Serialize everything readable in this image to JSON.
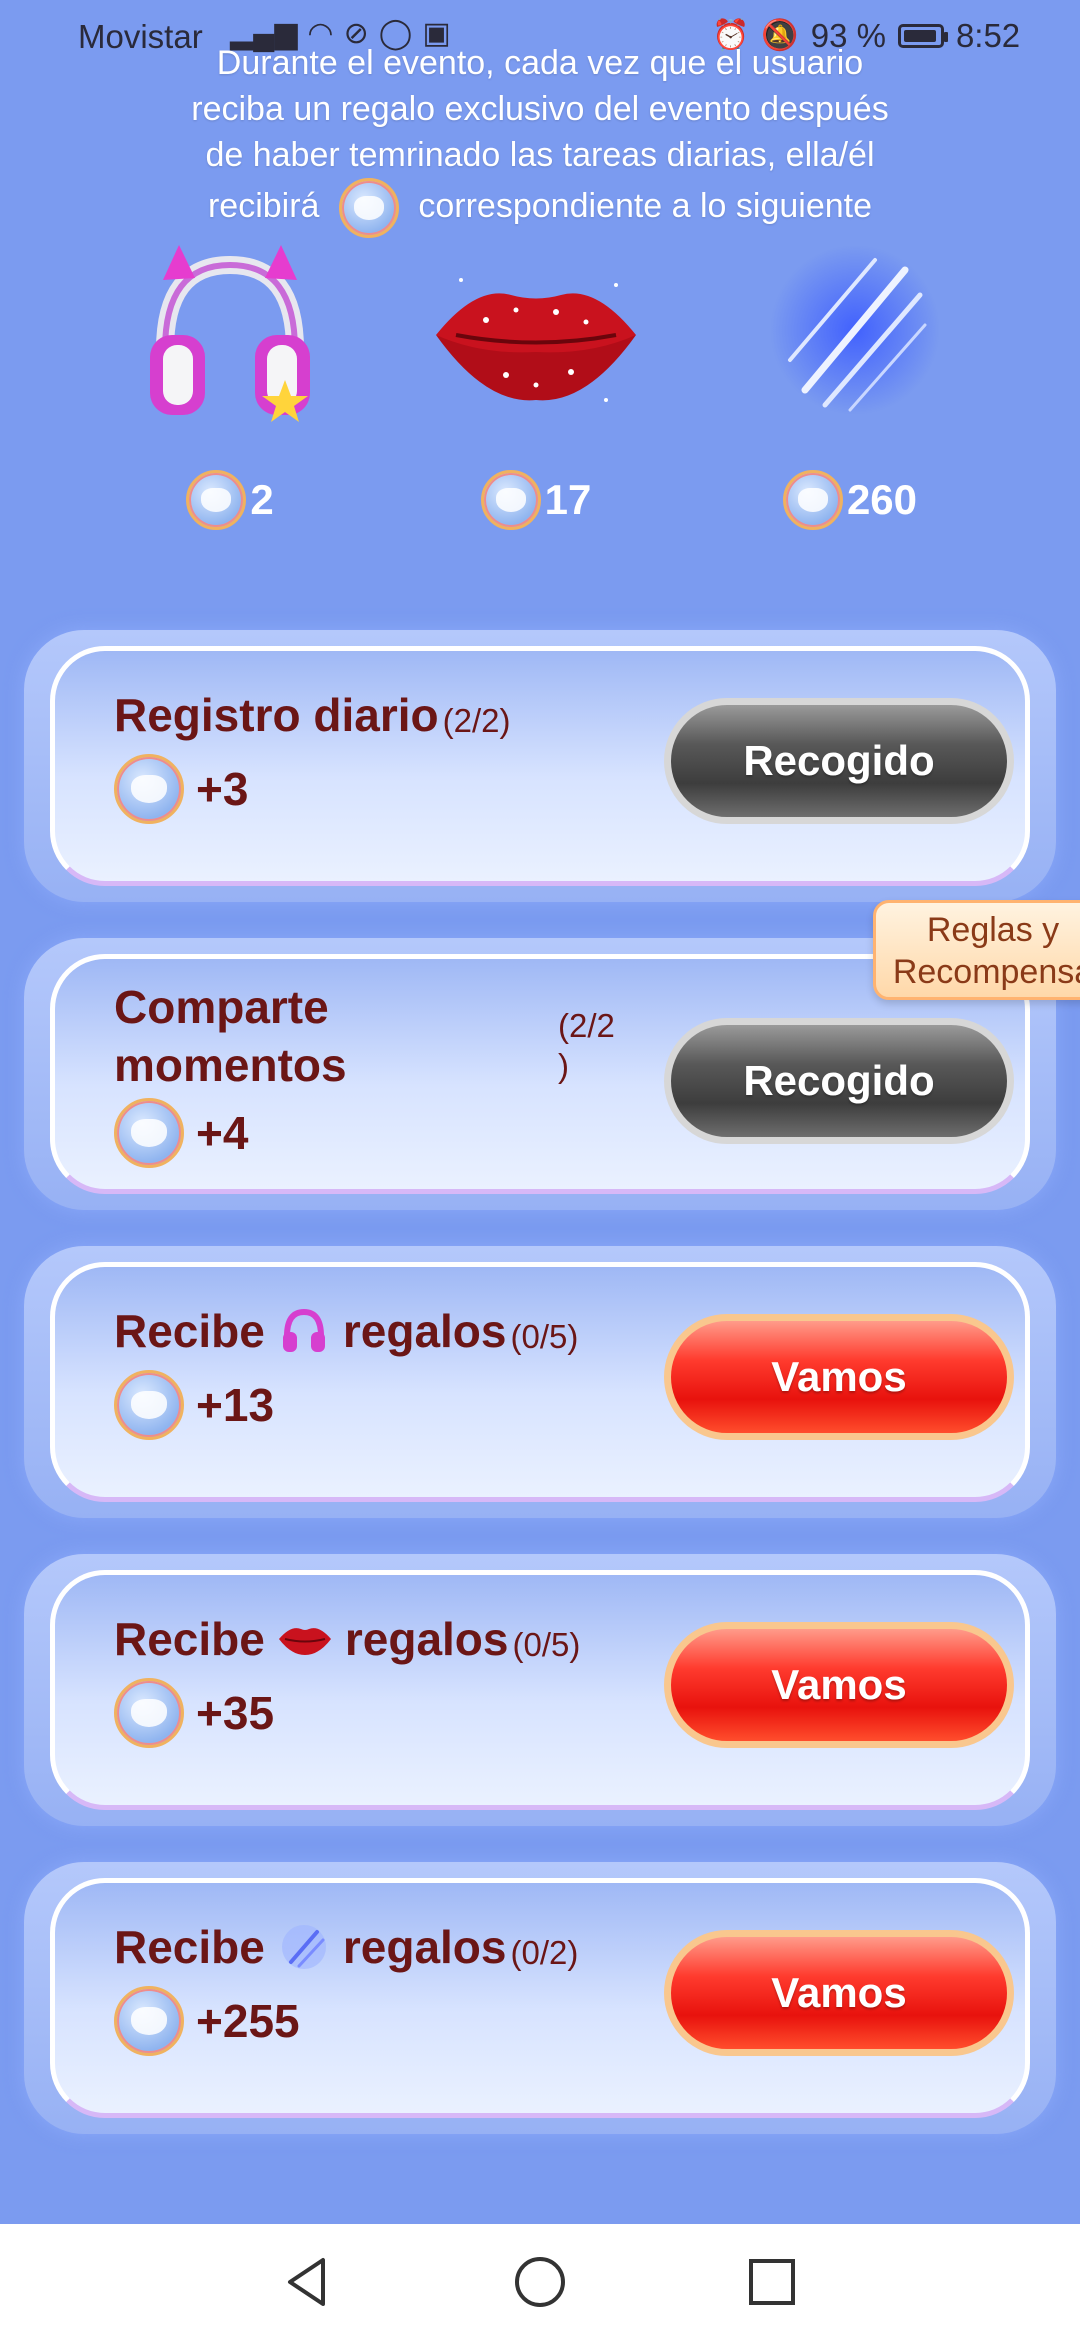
{
  "status_bar": {
    "carrier": "Movistar",
    "battery_percent": "93 %",
    "time": "8:52"
  },
  "intro": {
    "line1": "Durante el evento, cada vez que el usuario",
    "line2": "reciba un regalo exclusivo del evento después",
    "line3": "de haber temrinado las tareas diarias, ella/él",
    "line4_before": "recibirá",
    "line4_after": "correspondiente a lo siguiente"
  },
  "gifts": [
    {
      "name": "headphones-gift",
      "cost": "2"
    },
    {
      "name": "lips-gift",
      "cost": "17"
    },
    {
      "name": "meteor-gift",
      "cost": "260"
    }
  ],
  "tasks": [
    {
      "title": "Registro diario",
      "progress": "(2/2)",
      "reward": "+3",
      "button": "Recogido",
      "state": "collected"
    },
    {
      "title_line1": "Comparte",
      "title_line2": "momentos",
      "progress_line1": "(2/2",
      "progress_line2": ")",
      "reward": "+4",
      "button": "Recogido",
      "state": "collected"
    },
    {
      "title_before": "Recibe",
      "title_after": "regalos",
      "progress": "(0/5)",
      "reward": "+13",
      "button": "Vamos",
      "state": "go"
    },
    {
      "title_before": "Recibe",
      "title_after": "regalos",
      "progress": "(0/5)",
      "reward": "+35",
      "button": "Vamos",
      "state": "go"
    },
    {
      "title_before": "Recibe",
      "title_after": "regalos",
      "progress": "(0/2)",
      "reward": "+255",
      "button": "Vamos",
      "state": "go"
    }
  ],
  "rules_tab": {
    "line1": "Reglas y",
    "line2": "Recompensa"
  },
  "colors": {
    "background": "#7b9bf0",
    "task_text": "#6b1616",
    "go_button": "#e8120d",
    "done_button": "#4a4a4a"
  },
  "nav": {
    "back_icon": "back-triangle-icon",
    "home_icon": "home-circle-icon",
    "recents_icon": "recents-square-icon"
  }
}
